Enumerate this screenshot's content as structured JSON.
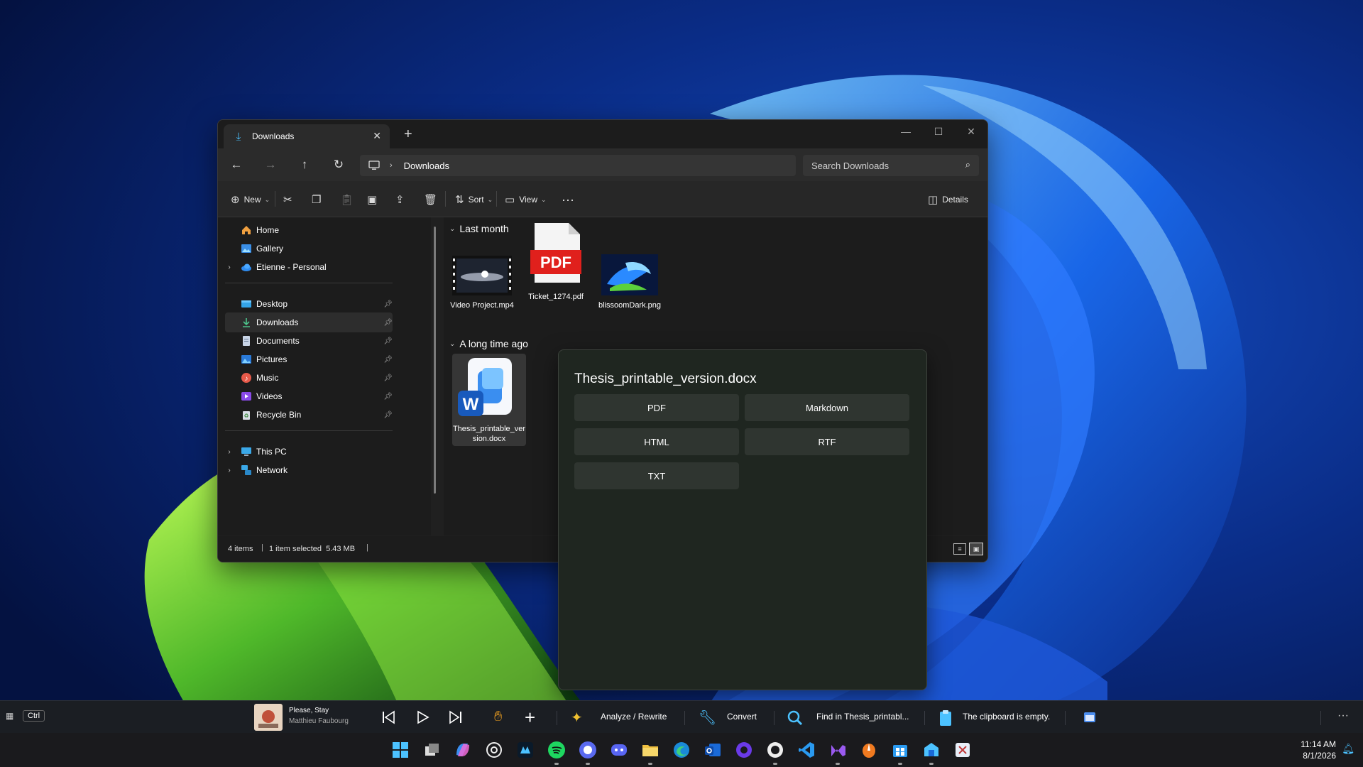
{
  "window": {
    "tab_title": "Downloads",
    "address_root_icon": "pc-icon",
    "address_path": "Downloads",
    "search_placeholder": "Search Downloads"
  },
  "commandbar": {
    "new_label": "New",
    "sort_label": "Sort",
    "view_label": "View",
    "details_label": "Details"
  },
  "sidebar": {
    "items": [
      {
        "label": "Home",
        "icon": "home-icon"
      },
      {
        "label": "Gallery",
        "icon": "gallery-icon"
      },
      {
        "label": "Etienne - Personal",
        "icon": "onedrive-icon"
      },
      {
        "label": "Desktop",
        "icon": "desktop-icon"
      },
      {
        "label": "Downloads",
        "icon": "download-icon"
      },
      {
        "label": "Documents",
        "icon": "documents-icon"
      },
      {
        "label": "Pictures",
        "icon": "pictures-icon"
      },
      {
        "label": "Music",
        "icon": "music-icon"
      },
      {
        "label": "Videos",
        "icon": "videos-icon"
      },
      {
        "label": "Recycle Bin",
        "icon": "recycle-bin-icon"
      },
      {
        "label": "This PC",
        "icon": "pc-icon"
      },
      {
        "label": "Network",
        "icon": "network-icon"
      }
    ]
  },
  "content": {
    "groups": [
      {
        "header": "Last month"
      },
      {
        "header": "A long time ago"
      }
    ],
    "files": [
      {
        "name": "Video Project.mp4"
      },
      {
        "name": "Ticket_1274.pdf",
        "badge": "PDF"
      },
      {
        "name": "blissoomDark.png"
      },
      {
        "name": "Thesis_printable_version.docx",
        "badge": "W"
      }
    ]
  },
  "status": {
    "count": "4 items",
    "selection": "1 item selected  5.43 MB"
  },
  "popup": {
    "title": "Thesis_printable_version.docx",
    "formats": [
      "PDF",
      "Markdown",
      "HTML",
      "RTF",
      "TXT"
    ]
  },
  "toolbar": {
    "key1": "Ctrl",
    "track_title": "Please, Stay",
    "track_artist": "Matthieu Faubourg",
    "analyze_label": "Analyze / Rewrite",
    "convert_label": "Convert",
    "find_label": "Find in Thesis_printabl...",
    "clipboard_label": "The clipboard is empty."
  },
  "taskbar": {
    "time": "11:14 AM",
    "date": "8/1/2026"
  },
  "colors": {
    "accent": "#4cc2ff",
    "pdf_red": "#e0201c",
    "word_blue": "#185abd"
  }
}
